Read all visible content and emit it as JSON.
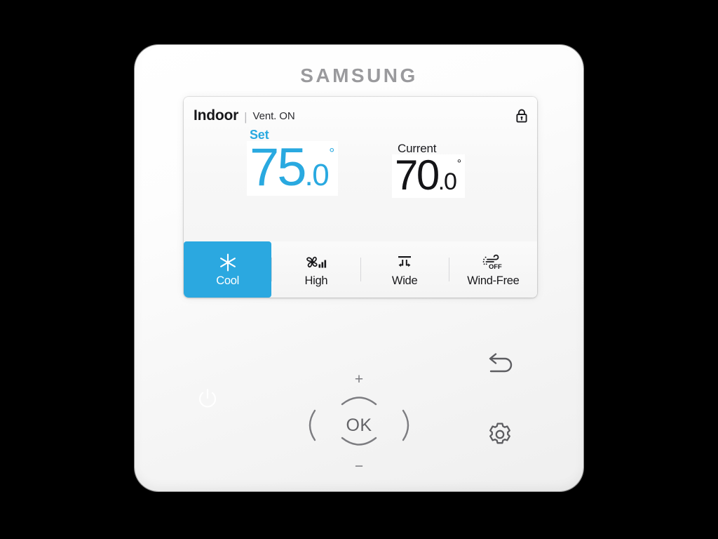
{
  "device": {
    "brand": "SAMSUNG",
    "brand_color": "#9a9a9d"
  },
  "screen": {
    "status": {
      "zone_label": "Indoor",
      "separator": "|",
      "vent_status": "Vent. ON",
      "lock_icon": "lock-closed-icon"
    },
    "set_temperature": {
      "label": "Set",
      "whole": "75",
      "decimal": ".0",
      "degree": "°",
      "color": "#29a9e0"
    },
    "current_temperature": {
      "label": "Current",
      "whole": "70",
      "decimal": ".0",
      "degree": "°",
      "color": "#141417"
    },
    "functions": [
      {
        "label": "Cool",
        "icon": "snowflake-icon",
        "active": true
      },
      {
        "label": "High",
        "icon": "fan-speed-icon",
        "active": false
      },
      {
        "label": "Wide",
        "icon": "airflow-wide-icon",
        "active": false
      },
      {
        "label": "Wind-Free",
        "icon": "wind-free-off-icon",
        "active": false
      }
    ],
    "accent_color": "#2ba8e0"
  },
  "controls": {
    "power": {
      "icon": "power-icon"
    },
    "dpad": {
      "plus": "+",
      "minus": "−",
      "up_icon": "chevron-up-icon",
      "down_icon": "chevron-down-icon",
      "left_icon": "chevron-left-icon",
      "right_icon": "chevron-right-icon",
      "ok_label": "OK"
    },
    "back": {
      "icon": "back-arrow-icon"
    },
    "settings": {
      "icon": "gear-icon"
    }
  }
}
